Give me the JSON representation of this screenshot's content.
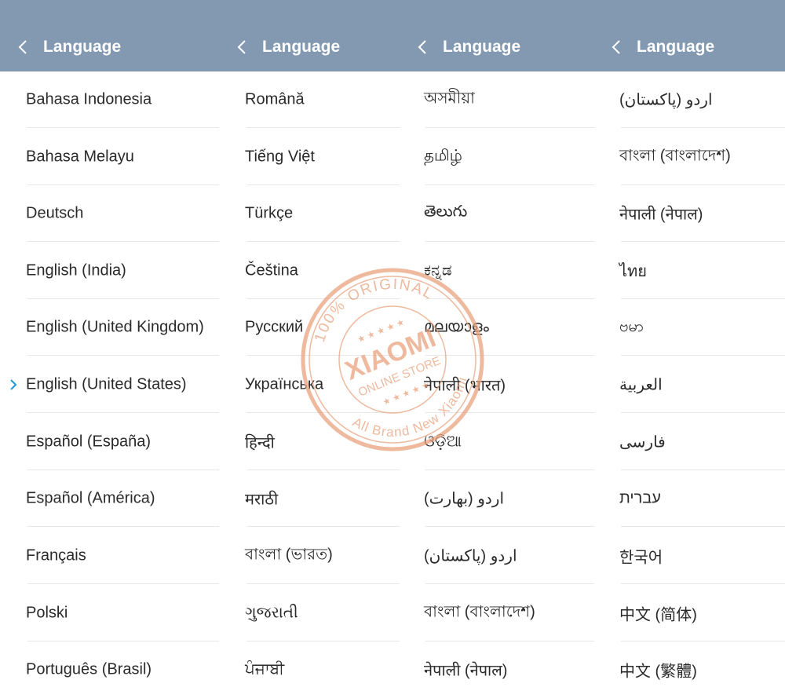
{
  "screens": [
    {
      "title": "Language",
      "selected_index": 5,
      "items": [
        "Bahasa Indonesia",
        "Bahasa Melayu",
        "Deutsch",
        "English (India)",
        "English (United Kingdom)",
        "English (United States)",
        "Español (España)",
        "Español (América)",
        "Français",
        "Polski",
        "Português (Brasil)"
      ]
    },
    {
      "title": "Language",
      "items": [
        "Română",
        "Tiếng Việt",
        "Türkçe",
        "Čeština",
        "Русский",
        "Українська",
        "हिन्दी",
        "मराठी",
        "বাংলা (ভারত)",
        "ગુજરાતી",
        "ਪੰਜਾਬੀ"
      ]
    },
    {
      "title": "Language",
      "items": [
        "অসমীয়া",
        "தமிழ்",
        "తెలుగు",
        "ಕನ್ನಡ",
        "മലയാളം",
        "नेपाली (भारत)",
        "ଓଡ଼ିଆ",
        "اردو (بھارت)",
        "اردو (پاکستان)",
        "বাংলা (বাংলাদেশ)",
        "नेपाली (नेपाल)"
      ]
    },
    {
      "title": "Language",
      "items": [
        "اردو (پاکستان)",
        "বাংলা (বাংলাদেশ)",
        "नेपाली (नेपाल)",
        "ไทย",
        "ဗမာ",
        "العربية",
        "فارسی",
        "עברית",
        "한국어",
        "中文 (简体)",
        "中文 (繁體)"
      ]
    }
  ],
  "watermark": {
    "line1": "100% ORIGINAL",
    "line2": "XIAOMI",
    "line3": "ONLINE STORE",
    "line4": "All Brand New Xiaomi",
    "color": "#e9a27d"
  },
  "colors": {
    "header": "#8399b1",
    "accent": "#1c9ad6"
  }
}
